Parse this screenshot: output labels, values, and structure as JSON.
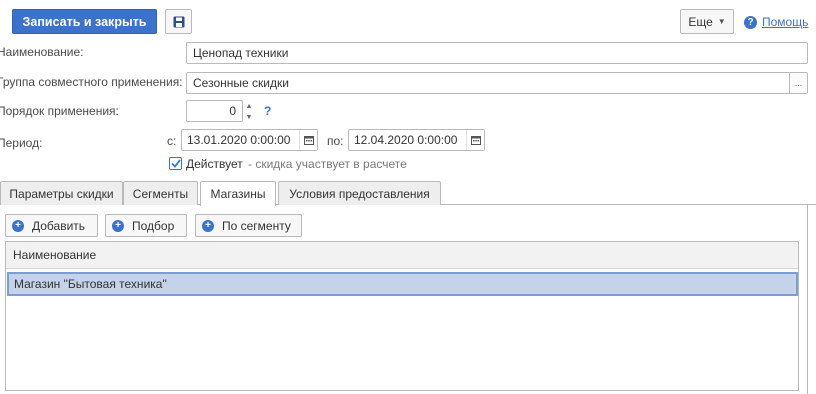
{
  "toolbar": {
    "save_close_label": "Записать и закрыть",
    "save_icon": "floppy-disk-icon",
    "more_label": "Еще",
    "help_label": "Помощь",
    "help_icon": "question-circle-icon"
  },
  "form": {
    "name_label": "Наименование:",
    "name_value": "Ценопад техники",
    "group_label": "Группа совместного применения:",
    "group_value": "Сезонные скидки",
    "group_choice": "...",
    "order_label": "Порядок применения:",
    "order_value": "0",
    "order_help": "?",
    "period_label": "Период:",
    "from_label": "с:",
    "from_value": "13.01.2020  0:00:00",
    "to_label": "по:",
    "to_value": "12.04.2020  0:00:00",
    "active_checked": true,
    "active_label": "Действует",
    "active_hint": "- скидка участвует в расчете"
  },
  "tabs": [
    {
      "label": "Параметры скидки",
      "active": false
    },
    {
      "label": "Сегменты",
      "active": false
    },
    {
      "label": "Магазины",
      "active": true
    },
    {
      "label": "Условия предоставления",
      "active": false
    }
  ],
  "panel": {
    "buttons": {
      "add": "Добавить",
      "select": "Подбор",
      "by_segment": "По сегменту"
    },
    "table": {
      "columns": [
        "Наименование"
      ],
      "rows": [
        {
          "name": "Магазин \"Бытовая техника\"",
          "selected": true
        }
      ]
    }
  },
  "colors": {
    "accent": "#3a73c9",
    "selection": "#c4d3ea"
  }
}
